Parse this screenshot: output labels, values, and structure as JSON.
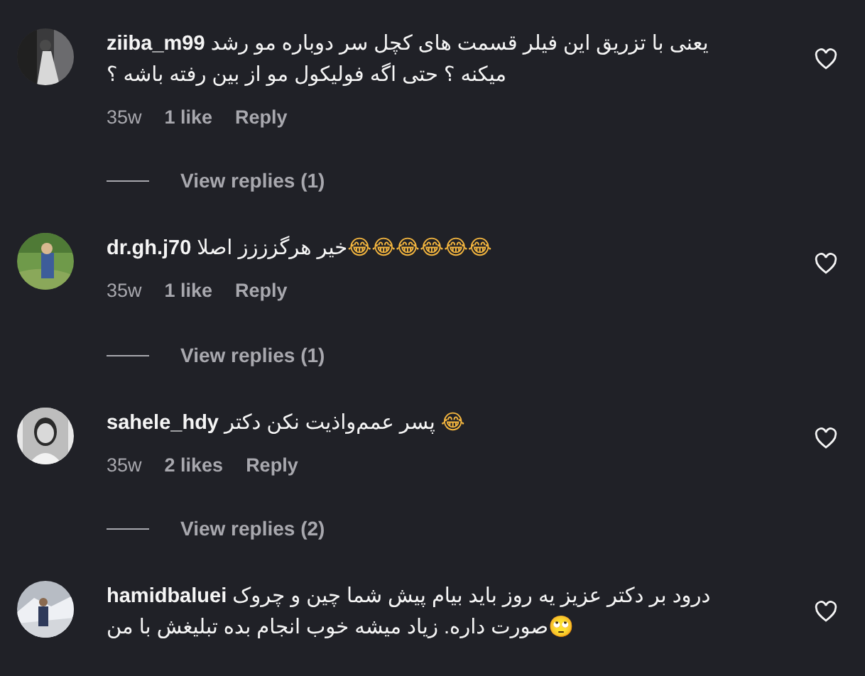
{
  "comments": [
    {
      "username": "ziiba_m99",
      "text": "یعنی با تزریق این فیلر قسمت های کچل سر دوباره مو رشد میکنه ؟ حتی اگه فولیکول مو از بین رفته باشه ؟",
      "time": "35w",
      "likes": "1 like",
      "reply": "Reply",
      "view_replies": "View replies (1)"
    },
    {
      "username": "dr.gh.j70",
      "text": "خیر هرگزززز اصلا😂😂😂😂😂😂",
      "time": "35w",
      "likes": "1 like",
      "reply": "Reply",
      "view_replies": "View replies (1)"
    },
    {
      "username": "sahele_hdy",
      "text": "پسر عمم‌واذیت نکن دکتر 😂",
      "time": "35w",
      "likes": "2 likes",
      "reply": "Reply",
      "view_replies": "View replies (2)"
    },
    {
      "username": "hamidbaluei",
      "text": "درود بر دکتر عزیز یه روز باید بیام پیش شما چین و چروک صورت داره. زیاد میشه خوب انجام بده تبلیغش با من🙄"
    }
  ]
}
